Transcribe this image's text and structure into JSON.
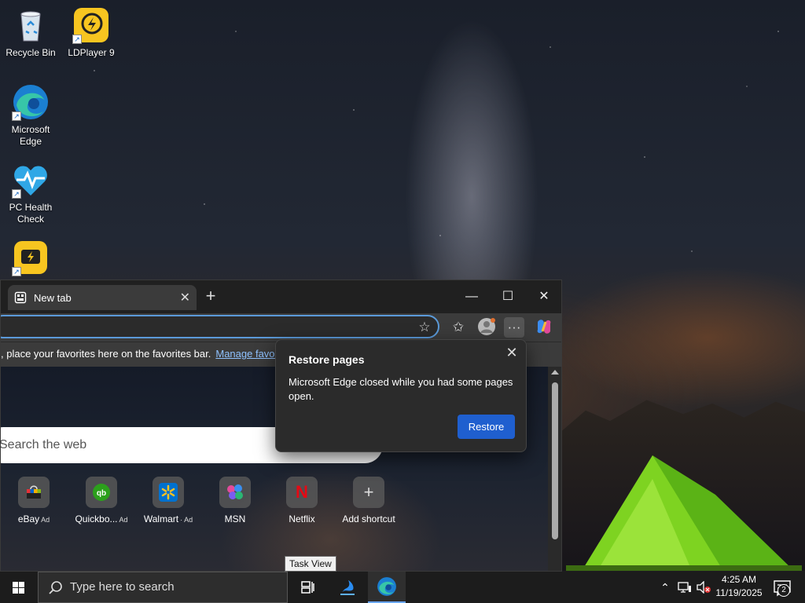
{
  "desktop": {
    "icons": [
      {
        "label": "Recycle Bin",
        "icon": "recycle-bin-icon"
      },
      {
        "label": "LDPlayer 9",
        "icon": "ldplayer-icon"
      },
      {
        "label": "Microsoft Edge",
        "icon": "edge-icon"
      },
      {
        "label": "PC Health Check",
        "icon": "pc-health-check-icon"
      },
      {
        "label": "",
        "icon": "ldmultiplayer-icon"
      }
    ]
  },
  "browser": {
    "tab_title": "New tab",
    "favorites_bar_text": ", place your favorites here on the favorites bar.",
    "favorites_link": "Manage favorites",
    "search_placeholder": "Search the web",
    "shortcuts": [
      {
        "label": "eBay",
        "ad": "Ad",
        "icon": "ebay-icon"
      },
      {
        "label": "Quickbo...",
        "ad": "Ad",
        "icon": "quickbooks-icon"
      },
      {
        "label": "Walmart",
        "ad": "· Ad",
        "icon": "walmart-icon"
      },
      {
        "label": "MSN",
        "ad": "",
        "icon": "msn-icon"
      },
      {
        "label": "Netflix",
        "ad": "",
        "icon": "netflix-icon"
      },
      {
        "label": "Add shortcut",
        "ad": "",
        "icon": "plus-icon"
      }
    ]
  },
  "popup": {
    "title": "Restore pages",
    "body": "Microsoft Edge closed while you had some pages open.",
    "button": "Restore"
  },
  "tooltip": "Task View",
  "taskbar": {
    "search_placeholder": "Type here to search",
    "time": "4:25 AM",
    "date": "11/19/2025",
    "notification_count": "2"
  },
  "colors": {
    "accent": "#1f5fcf",
    "taskbar": "#1c1c1c",
    "tent": "#7ed321"
  }
}
